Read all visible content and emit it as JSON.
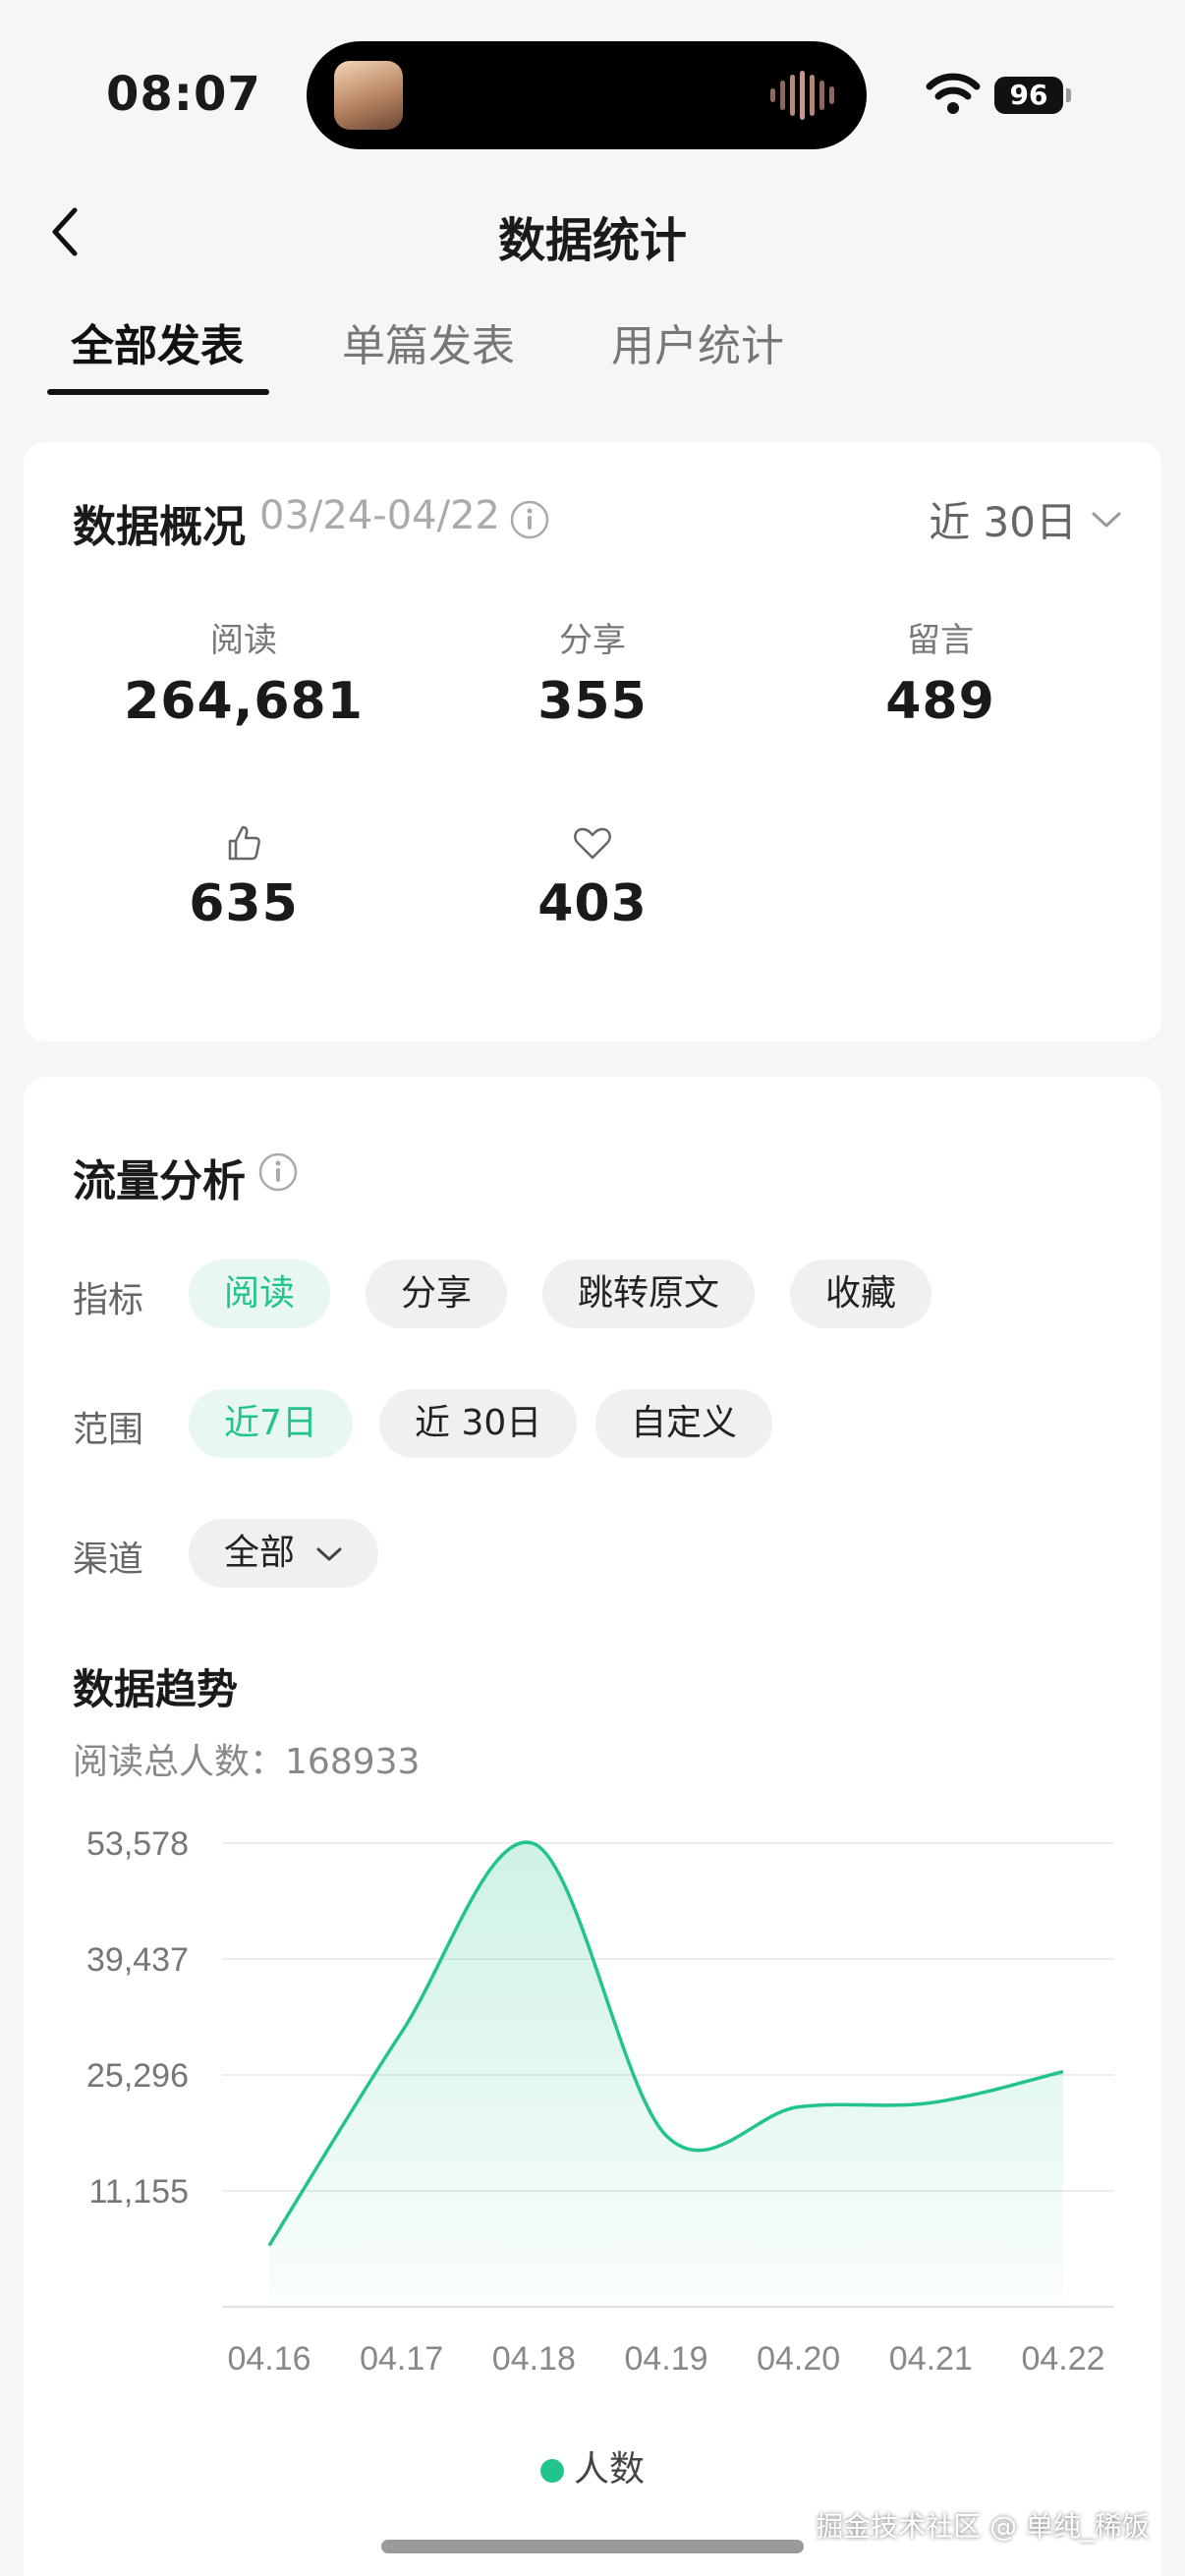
{
  "status_bar": {
    "time": "08:07",
    "battery": "96"
  },
  "nav": {
    "title": "数据统计"
  },
  "tabs": [
    {
      "label": "全部发表",
      "active": true
    },
    {
      "label": "单篇发表",
      "active": false
    },
    {
      "label": "用户统计",
      "active": false
    }
  ],
  "overview": {
    "title": "数据概况",
    "range": "03/24-04/22",
    "period": "近 30日",
    "metrics": {
      "read": {
        "label": "阅读",
        "value": "264,681"
      },
      "share": {
        "label": "分享",
        "value": "355"
      },
      "comment": {
        "label": "留言",
        "value": "489"
      },
      "like": {
        "icon": "thumbs-up-icon",
        "value": "635"
      },
      "favorite": {
        "icon": "heart-icon",
        "value": "403"
      }
    }
  },
  "traffic": {
    "title": "流量分析",
    "indicator_label": "指标",
    "indicators": [
      "阅读",
      "分享",
      "跳转原文",
      "收藏"
    ],
    "range_label": "范围",
    "ranges": [
      "近7日",
      "近 30日",
      "自定义"
    ],
    "channel_label": "渠道",
    "channel_value": "全部",
    "trend_title": "数据趋势",
    "total_label": "阅读总人数：",
    "total_value": "168933"
  },
  "chart_data": {
    "type": "area",
    "x": [
      "04.16",
      "04.17",
      "04.18",
      "04.19",
      "04.20",
      "04.21",
      "04.22"
    ],
    "series": [
      {
        "name": "人数",
        "values": [
          4500,
          30500,
          53500,
          17900,
          21400,
          21900,
          25700
        ],
        "color": "#23c38c"
      }
    ],
    "yticks": [
      "53,578",
      "39,437",
      "25,296",
      "11,155"
    ],
    "ytick_values": [
      53578,
      39437,
      25296,
      11155
    ],
    "ylim": [
      -2986,
      53578
    ],
    "grid": true,
    "legend": "bottom-center"
  },
  "watermark": "掘金技术社区 @ 单纯_稀饭"
}
